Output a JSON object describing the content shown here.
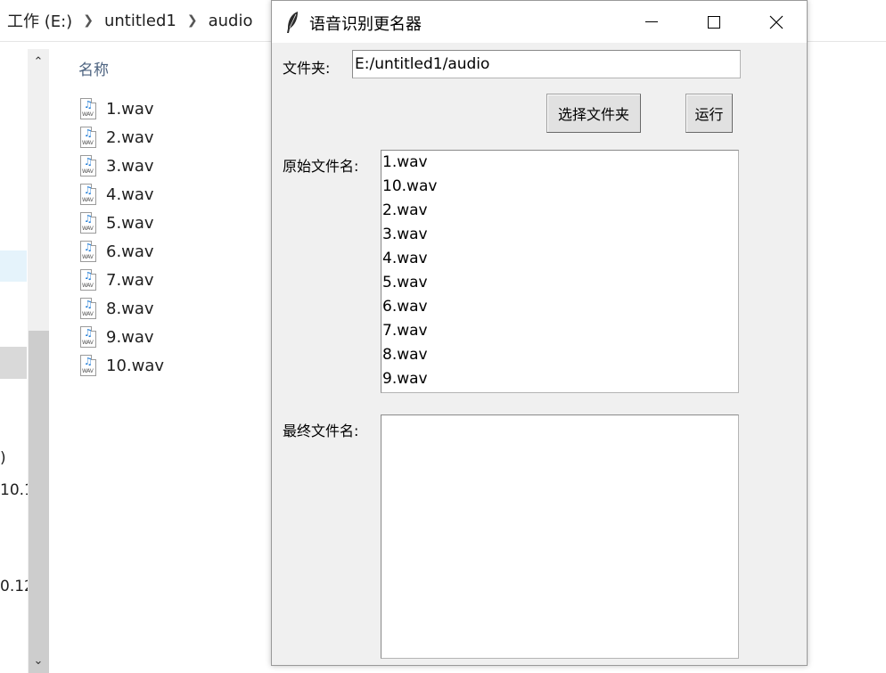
{
  "explorer": {
    "breadcrumb": [
      "工作 (E:)",
      "untitled1",
      "audio"
    ],
    "column_header": "名称",
    "files": [
      "1.wav",
      "2.wav",
      "3.wav",
      "4.wav",
      "5.wav",
      "6.wav",
      "7.wav",
      "8.wav",
      "9.wav",
      "10.wav"
    ],
    "nav_fragments": [
      ")",
      "10.1",
      "0.12"
    ]
  },
  "dialog": {
    "title": "语音识别更名器",
    "folder_label": "文件夹:",
    "folder_value": "E:/untitled1/audio",
    "choose_button": "选择文件夹",
    "run_button": "运行",
    "original_label": "原始文件名:",
    "original_files": [
      "1.wav",
      "10.wav",
      "2.wav",
      "3.wav",
      "4.wav",
      "5.wav",
      "6.wav",
      "7.wav",
      "8.wav",
      "9.wav"
    ],
    "final_label": "最终文件名:",
    "final_files": []
  },
  "icons": {
    "breadcrumb_sep": "chevron-right-icon",
    "file": "wav-file-icon",
    "app": "feather-icon",
    "minimize": "minimize-icon",
    "maximize": "maximize-icon",
    "close": "close-icon"
  }
}
